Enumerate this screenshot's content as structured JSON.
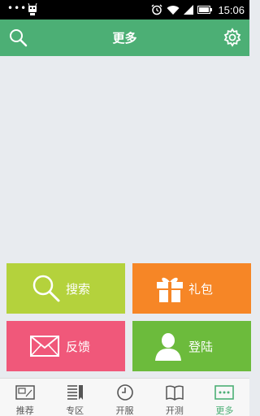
{
  "status_bar": {
    "dots": "•••",
    "time": "15:06",
    "icons": [
      "notification-bot-icon",
      "alarm-icon",
      "wifi-icon",
      "signal-icon",
      "battery-icon"
    ]
  },
  "header": {
    "title": "更多",
    "icons": [
      "search-icon",
      "gear-icon"
    ]
  },
  "colors": {
    "accent": "#4caf75",
    "search_tile": "#b4d23c",
    "gift_tile": "#f68626",
    "feedback_tile": "#f0587a",
    "login_tile": "#6cbb3c",
    "background": "#e8ebef"
  },
  "tiles": [
    {
      "label": "搜索",
      "icon": "search-icon"
    },
    {
      "label": "礼包",
      "icon": "gift-icon"
    },
    {
      "label": "反馈",
      "icon": "envelope-icon"
    },
    {
      "label": "登陆",
      "icon": "user-icon"
    }
  ],
  "bottom_nav": {
    "items": [
      {
        "label": "推荐",
        "icon": "recommend-icon"
      },
      {
        "label": "专区",
        "icon": "bookmark-icon"
      },
      {
        "label": "开服",
        "icon": "clock-icon"
      },
      {
        "label": "开测",
        "icon": "book-icon"
      },
      {
        "label": "更多",
        "icon": "more-icon"
      }
    ],
    "active": "更多"
  }
}
